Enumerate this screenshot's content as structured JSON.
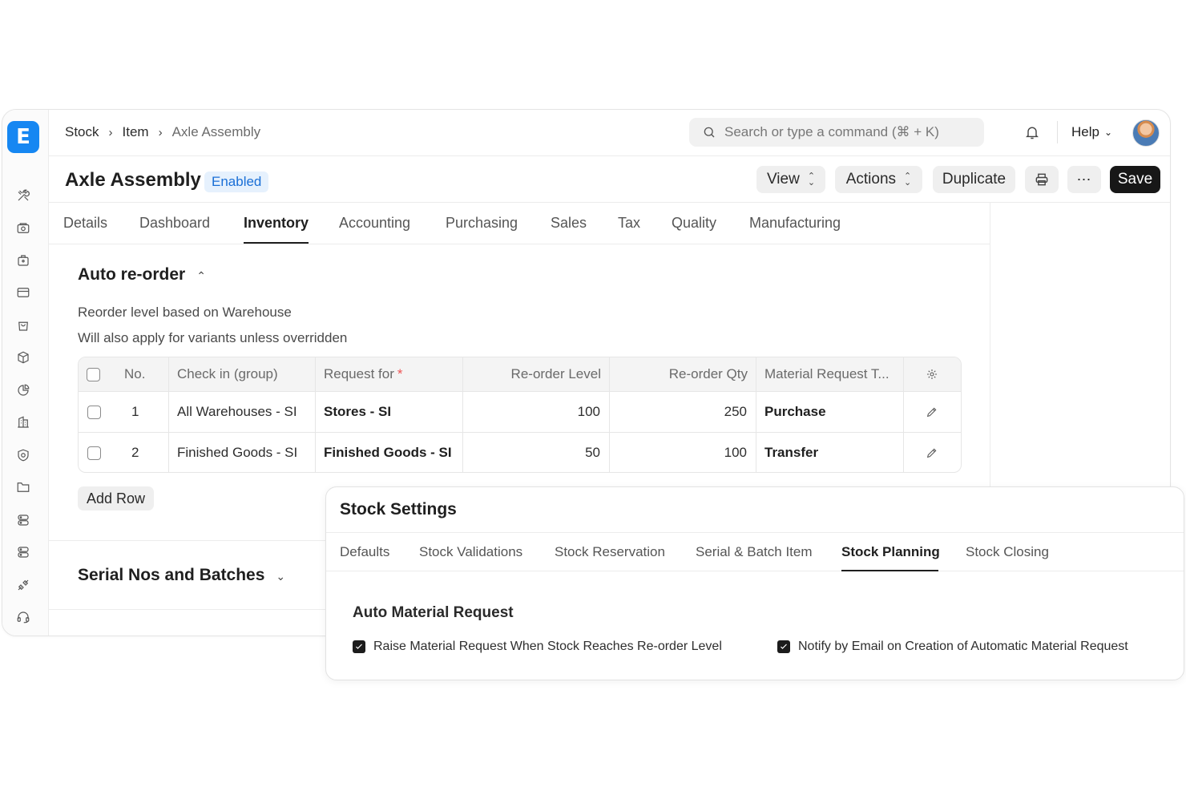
{
  "app": {
    "logo_letter": "E"
  },
  "breadcrumb": {
    "items": [
      "Stock",
      "Item",
      "Axle Assembly"
    ]
  },
  "search": {
    "placeholder": "Search or type a command (⌘ + K)"
  },
  "header": {
    "help_label": "Help"
  },
  "page": {
    "title": "Axle Assembly",
    "status": "Enabled",
    "buttons": {
      "view": "View",
      "actions": "Actions",
      "duplicate": "Duplicate",
      "save": "Save"
    }
  },
  "tabs": [
    "Details",
    "Dashboard",
    "Inventory",
    "Accounting",
    "Purchasing",
    "Sales",
    "Tax",
    "Quality",
    "Manufacturing"
  ],
  "active_tab": "Inventory",
  "auto_reorder": {
    "title": "Auto re-order",
    "description_1": "Reorder level based on Warehouse",
    "description_2": "Will also apply for variants unless overridden",
    "table": {
      "headers": [
        "No.",
        "Check in (group)",
        "Request for",
        "Re-order Level",
        "Re-order Qty",
        "Material Request T..."
      ],
      "required_marker": "*",
      "rows": [
        {
          "no": "1",
          "check_in": "All Warehouses - SI",
          "request_for": "Stores - SI",
          "reorder_level": "100",
          "reorder_qty": "250",
          "material_request_type": "Purchase"
        },
        {
          "no": "2",
          "check_in": "Finished Goods - SI",
          "request_for": "Finished Goods - SI",
          "reorder_level": "50",
          "reorder_qty": "100",
          "material_request_type": "Transfer"
        }
      ]
    },
    "add_row_label": "Add Row"
  },
  "serial_section": {
    "title": "Serial Nos and Batches"
  },
  "stock_settings": {
    "title": "Stock Settings",
    "tabs": [
      "Defaults",
      "Stock Validations",
      "Stock Reservation",
      "Serial & Batch Item",
      "Stock Planning",
      "Stock Closing"
    ],
    "active_tab": "Stock Planning",
    "section_title": "Auto Material Request",
    "checkboxes": [
      {
        "label": "Raise Material Request When Stock Reaches Re-order Level",
        "checked": true
      },
      {
        "label": "Notify by Email on Creation of Automatic Material Request",
        "checked": true
      }
    ]
  },
  "icons": {
    "sidebar": [
      "tools-icon",
      "box-icon",
      "briefcase-icon",
      "card-icon",
      "bag-icon",
      "cube-icon",
      "chart-icon",
      "building-icon",
      "shield-icon",
      "folder-icon",
      "server-icon",
      "server-icon",
      "integration-icon",
      "headset-icon"
    ]
  },
  "colors": {
    "brand": "#1687f2",
    "save_button": "#171717",
    "badge_bg": "#e6f1fd",
    "badge_text": "#1a6fd6"
  }
}
